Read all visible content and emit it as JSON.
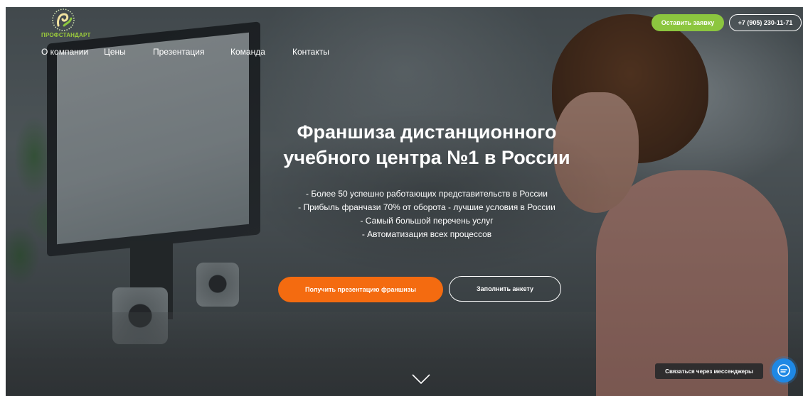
{
  "header": {
    "logo_text": "ПРОФСТАНДАРТ",
    "request_button": "Оставить заявку",
    "phone": "+7 (905) 230-11-71",
    "accent_color": "#8cc63f"
  },
  "nav": {
    "items": [
      {
        "label": "О компании"
      },
      {
        "label": "Цены"
      },
      {
        "label": "Презентация"
      },
      {
        "label": "Команда"
      },
      {
        "label": "Контакты"
      }
    ]
  },
  "hero": {
    "title_line1": "Франшиза дистанционного",
    "title_line2": "учебного центра №1 в России",
    "bullets": [
      "- Более 50 успешно работающих представительств в России",
      "- Прибыль франчази 70% от оборота - лучшие условия в России",
      "- Самый большой перечень услуг",
      "- Автоматизация всех процессов"
    ],
    "primary_button": "Получить презентацию франшизы",
    "primary_color": "#f46b10",
    "secondary_button": "Заполнить анкету",
    "scroll_icon": "chevron-down-icon"
  },
  "messenger": {
    "label": "Связаться через мессенджеры",
    "icon": "chat-bubble-icon",
    "color": "#1e88e5"
  }
}
